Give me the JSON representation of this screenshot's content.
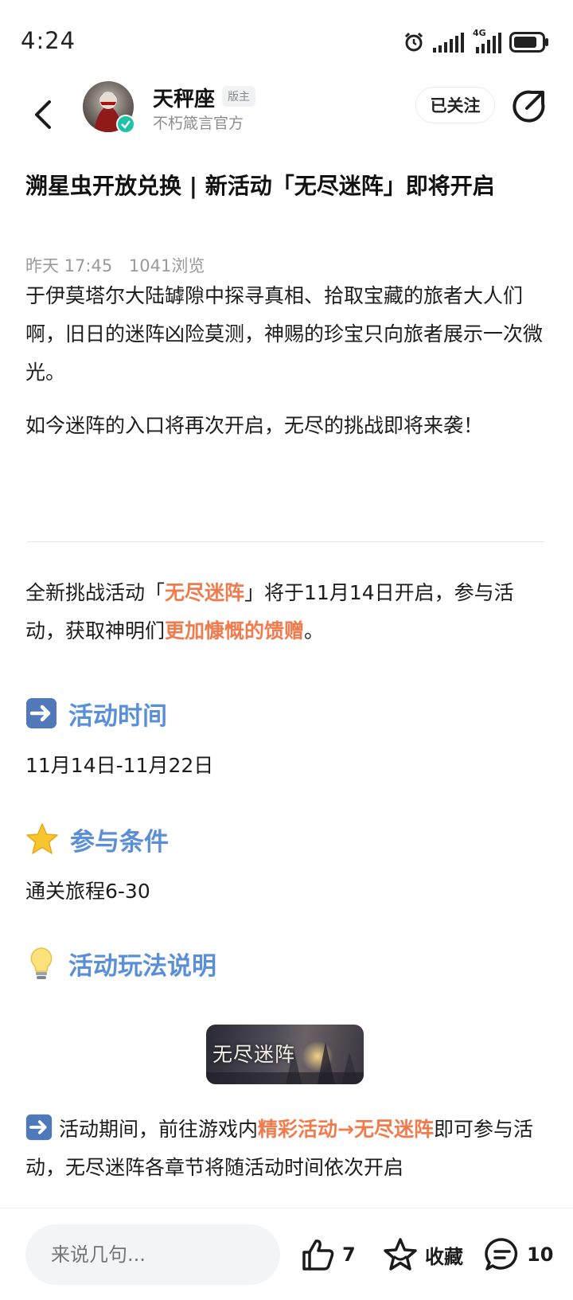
{
  "status_bar": {
    "time": "4:24",
    "icons": [
      "alarm-icon",
      "signal-icon",
      "4g-signal-icon",
      "battery-icon"
    ],
    "network_label": "4G"
  },
  "header": {
    "author_name": "天秤座",
    "author_badge": "版主",
    "author_subtitle": "不朽箴言官方",
    "follow_label": "已关注"
  },
  "article": {
    "title": "溯星虫开放兑换 | 新活动「无尽迷阵」即将开启",
    "meta_time": "昨天 17:45",
    "meta_views": "1041浏览",
    "paragraph1": "于伊莫塔尔大陆罅隙中探寻真相、拾取宝藏的旅者大人们啊，旧日的迷阵凶险莫测，神赐的珍宝只向旅者展示一次微光。",
    "paragraph2": "如今迷阵的入口将再次开启，无尽的挑战即将来袭！",
    "intro": {
      "p1_a": "全新挑战活动「",
      "p1_hl": "无尽迷阵",
      "p1_b": "」将于11月14日开启，参与活动，获取神明们",
      "p1_hl2": "更加慷慨的馈赠",
      "p1_c": "。"
    },
    "sections": [
      {
        "icon": "arrow-right-icon",
        "label": "活动时间",
        "body": "11月14日-11月22日"
      },
      {
        "icon": "star-icon",
        "label": "参与条件",
        "body": "通关旅程6-30"
      },
      {
        "icon": "lightbulb-icon",
        "label": "活动玩法说明"
      }
    ],
    "banner_title": "无尽迷阵",
    "detail": {
      "a": "活动期间，前往游戏内",
      "hl": "精彩活动→无尽迷阵",
      "b": "即可参与活动，无尽迷阵各章节将随活动时间依次开启"
    }
  },
  "bottom_bar": {
    "comment_placeholder": "来说几句...",
    "like_count": "7",
    "favorite_label": "收藏",
    "comment_count": "10"
  },
  "colors": {
    "accent_blue": "#5a8fd8",
    "highlight_orange": "#f07b4d",
    "verify_green": "#1fc2a6"
  }
}
